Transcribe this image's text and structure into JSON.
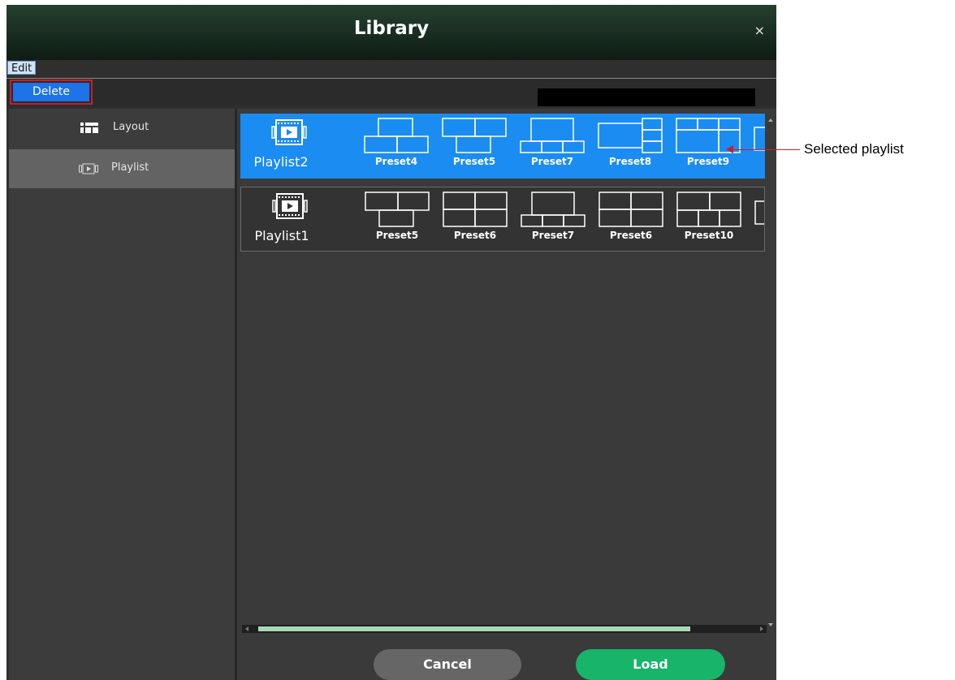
{
  "window": {
    "title": "Library",
    "close_glyph": "×"
  },
  "menu": {
    "edit_label": "Edit"
  },
  "toolbar": {
    "delete_label": "Delete",
    "search_value": ""
  },
  "sidebar": {
    "items": [
      {
        "label": "Layout",
        "icon": "layout-icon",
        "active": false
      },
      {
        "label": "Playlist",
        "icon": "playlist-icon",
        "active": true
      }
    ]
  },
  "playlists": [
    {
      "name": "Playlist2",
      "selected": true,
      "presets": [
        "Preset4",
        "Preset5",
        "Preset7",
        "Preset8",
        "Preset9"
      ]
    },
    {
      "name": "Playlist1",
      "selected": false,
      "presets": [
        "Preset5",
        "Preset6",
        "Preset7",
        "Preset6",
        "Preset10"
      ]
    }
  ],
  "buttons": {
    "cancel_label": "Cancel",
    "load_label": "Load"
  },
  "annotation": {
    "label": "Selected playlist"
  },
  "colors": {
    "selected_row": "#1a8cf2",
    "load_button": "#17b46a",
    "callout": "#c4202a"
  }
}
